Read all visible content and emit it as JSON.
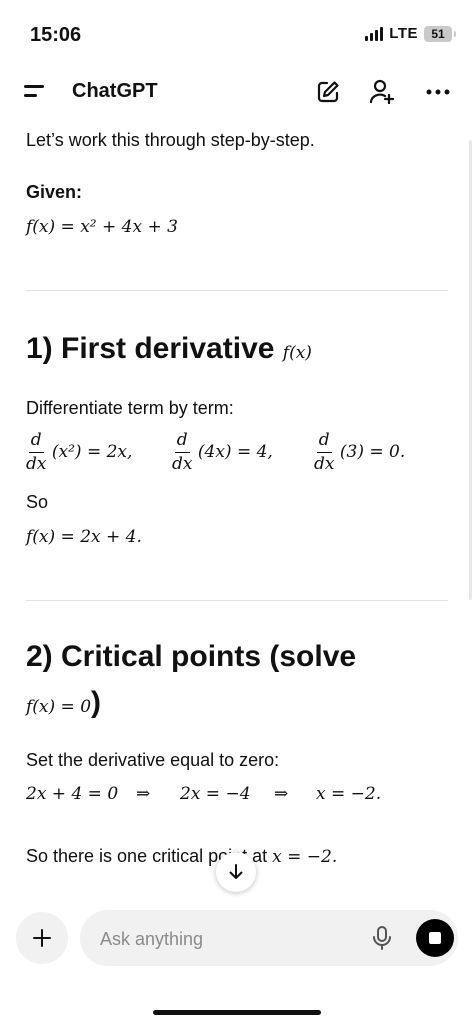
{
  "status": {
    "time": "15:06",
    "network": "LTE",
    "battery": "51"
  },
  "header": {
    "title": "ChatGPT"
  },
  "content": {
    "intro": "Let’s work this through step-by-step.",
    "given_label": "Given:",
    "given_eq": "f(x) = x² + 4x + 3",
    "section1": {
      "title": "1) First derivative",
      "title_math": "f(x)"
    },
    "diff_text": "Differentiate term by term:",
    "terms": [
      {
        "num": "d",
        "den": "dx",
        "expr": "(x²) = 2x,"
      },
      {
        "num": "d",
        "den": "dx",
        "expr": "(4x) = 4,"
      },
      {
        "num": "d",
        "den": "dx",
        "expr": "(3) = 0."
      }
    ],
    "so_label": "So",
    "result1": "f(x) = 2x + 4.",
    "section2": {
      "title": "2) Critical points (solve",
      "title_line2_math": "f(x) = 0",
      "title_line2_close": ")"
    },
    "set_text": "Set the derivative equal to zero:",
    "solve_steps": [
      "2x + 4 = 0",
      "⇒",
      "2x = −4",
      "⇒",
      "x = −2."
    ],
    "conclusion_text": "So there is one critical point at",
    "conclusion_math": "x = −2."
  },
  "composer": {
    "placeholder": "Ask anything"
  },
  "icons": {
    "menu": "menu-icon",
    "edit": "edit-icon",
    "add_user": "add-user-icon",
    "more": "more-icon",
    "scroll": "arrow-down-icon",
    "plus": "plus-icon",
    "mic": "mic-icon",
    "stop": "stop-icon"
  }
}
